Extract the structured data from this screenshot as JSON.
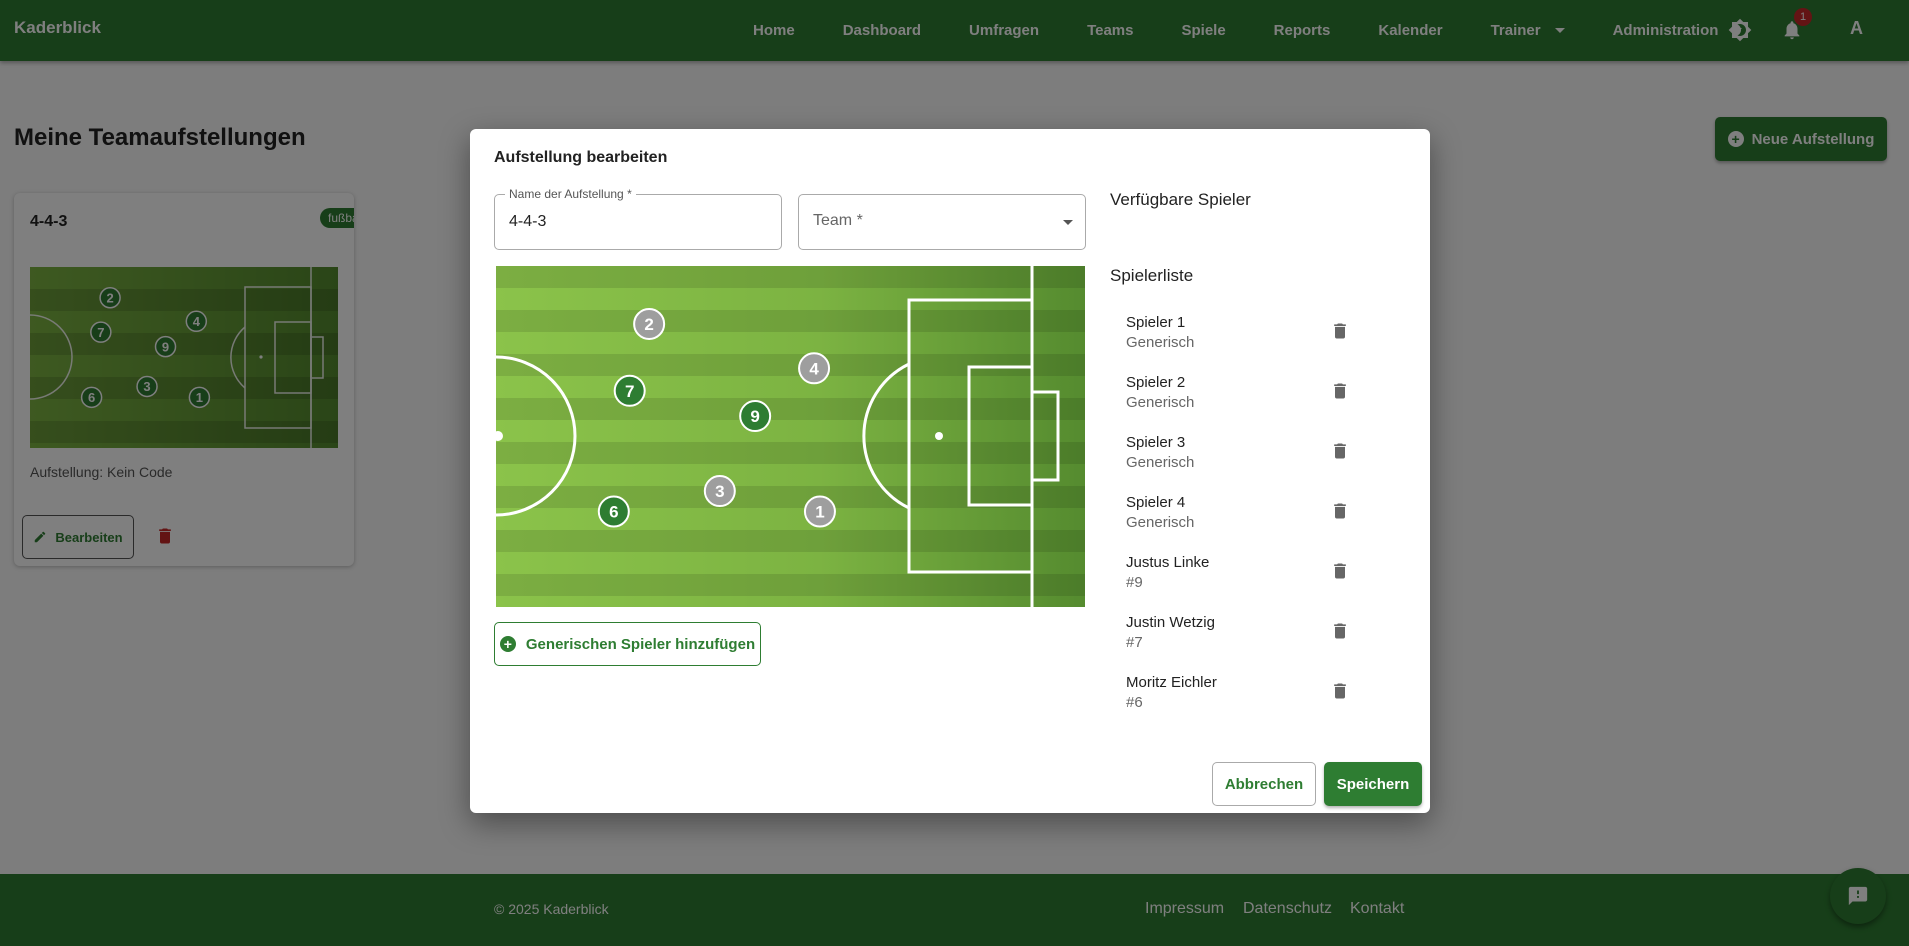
{
  "header": {
    "brand": "Kaderblick",
    "nav": [
      {
        "label": "Home",
        "dropdown": false
      },
      {
        "label": "Dashboard",
        "dropdown": false
      },
      {
        "label": "Umfragen",
        "dropdown": false
      },
      {
        "label": "Teams",
        "dropdown": false
      },
      {
        "label": "Spiele",
        "dropdown": false
      },
      {
        "label": "Reports",
        "dropdown": false
      },
      {
        "label": "Kalender",
        "dropdown": false
      },
      {
        "label": "Trainer",
        "dropdown": true
      },
      {
        "label": "Administration",
        "dropdown": true
      }
    ],
    "theme_icon": "brightness-icon",
    "notification_icon": "bell-icon",
    "notification_count": "1",
    "avatar_letter": "A"
  },
  "page": {
    "title": "Meine Teamaufstellungen",
    "new_button": "Neue Aufstellung"
  },
  "card": {
    "title": "4-4-3",
    "chip": "fußball",
    "code_text": "Aufstellung: Kein Code",
    "edit_button": "Bearbeiten",
    "players": [
      {
        "number": "2",
        "fx": 0.26,
        "fy": 0.17
      },
      {
        "number": "7",
        "fx": 0.23,
        "fy": 0.36
      },
      {
        "number": "4",
        "fx": 0.54,
        "fy": 0.3
      },
      {
        "number": "9",
        "fx": 0.44,
        "fy": 0.44
      },
      {
        "number": "6",
        "fx": 0.2,
        "fy": 0.72
      },
      {
        "number": "3",
        "fx": 0.38,
        "fy": 0.66
      },
      {
        "number": "1",
        "fx": 0.55,
        "fy": 0.72
      }
    ]
  },
  "dialog": {
    "title": "Aufstellung bearbeiten",
    "name_label": "Name der Aufstellung *",
    "name_value": "4-4-3",
    "team_placeholder": "Team *",
    "available_heading": "Verfügbare Spieler",
    "list_heading": "Spielerliste",
    "add_generic_button": "Generischen Spieler hinzufügen",
    "cancel_button": "Abbrechen",
    "save_button": "Speichern",
    "pitch_players": [
      {
        "number": "2",
        "fx": 0.26,
        "fy": 0.17,
        "generic": true
      },
      {
        "number": "4",
        "fx": 0.54,
        "fy": 0.3,
        "generic": true
      },
      {
        "number": "7",
        "fx": 0.227,
        "fy": 0.366,
        "generic": false
      },
      {
        "number": "9",
        "fx": 0.44,
        "fy": 0.44,
        "generic": false
      },
      {
        "number": "3",
        "fx": 0.38,
        "fy": 0.66,
        "generic": true
      },
      {
        "number": "6",
        "fx": 0.2,
        "fy": 0.72,
        "generic": false
      },
      {
        "number": "1",
        "fx": 0.55,
        "fy": 0.72,
        "generic": true
      }
    ],
    "players": [
      {
        "name": "Spieler 1",
        "sub": "Generisch"
      },
      {
        "name": "Spieler 2",
        "sub": "Generisch"
      },
      {
        "name": "Spieler 3",
        "sub": "Generisch"
      },
      {
        "name": "Spieler 4",
        "sub": "Generisch"
      },
      {
        "name": "Justus Linke",
        "sub": "#9"
      },
      {
        "name": "Justin Wetzig",
        "sub": "#7"
      },
      {
        "name": "Moritz Eichler",
        "sub": "#6"
      }
    ]
  },
  "footer": {
    "copyright": "© 2025 Kaderblick",
    "links": [
      "Impressum",
      "Datenschutz",
      "Kontakt"
    ],
    "fab_icon": "feedback-icon"
  },
  "colors": {
    "primary": "#2e7d32",
    "danger": "#c62828",
    "generic_player": "#9e9e9e",
    "team_player": "#2e7d32"
  }
}
